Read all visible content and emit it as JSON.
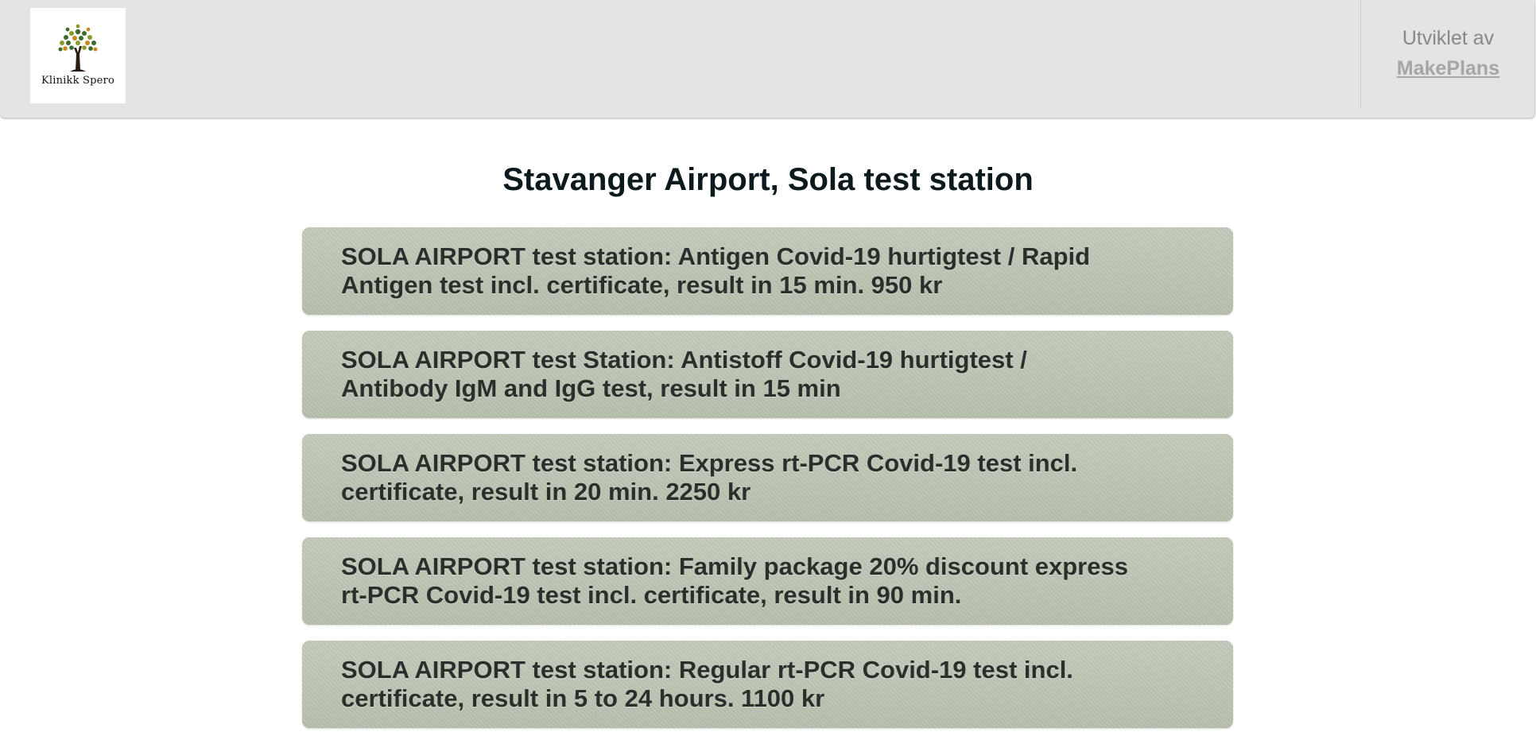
{
  "header": {
    "logo": {
      "icon": "tree-logo-icon",
      "text": "Klinikk Spero"
    },
    "credits": {
      "label": "Utviklet av",
      "link_text": "MakePlans"
    }
  },
  "main": {
    "title": "Stavanger Airport, Sola test station",
    "services": [
      {
        "label": "SOLA AIRPORT test station: Antigen Covid-19 hurtigtest / Rapid Antigen test incl. certificate, result in 15 min. 950 kr"
      },
      {
        "label": "SOLA AIRPORT test Station: Antistoff Covid-19 hurtigtest / Antibody IgM and IgG test, result in 15 min"
      },
      {
        "label": "SOLA AIRPORT test station: Express rt-PCR Covid-19 test incl. certificate, result in 20 min. 2250 kr"
      },
      {
        "label": "SOLA AIRPORT test station: Family package 20% discount express rt-PCR Covid-19 test incl. certificate, result in 90 min."
      },
      {
        "label": "SOLA AIRPORT test station: Regular rt-PCR Covid-19 test incl. certificate, result in 5 to 24 hours. 1100 kr"
      }
    ]
  },
  "colors": {
    "header_bg": "#e4e4e4",
    "service_bg": "#bcc3b2",
    "title_text": "#0d1a1d",
    "service_text": "#2b2f2c",
    "credits_text": "#888888"
  }
}
